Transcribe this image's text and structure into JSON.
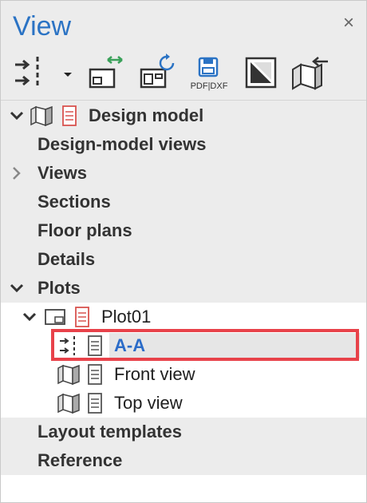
{
  "panel": {
    "title": "View",
    "close_symbol": "×"
  },
  "toolbar": {
    "buttons": [
      {
        "name": "section-cut-icon"
      },
      {
        "name": "dropdown-arrow-icon"
      },
      {
        "name": "layout-swap-icon"
      },
      {
        "name": "layout-refresh-icon"
      },
      {
        "name": "export-pdf-dxf-icon",
        "label": "PDF|DXF"
      },
      {
        "name": "render-toggle-icon"
      },
      {
        "name": "model-import-icon"
      }
    ]
  },
  "tree": {
    "design_model": "Design model",
    "design_model_views": "Design-model views",
    "views": "Views",
    "sections": "Sections",
    "floor_plans": "Floor plans",
    "details": "Details",
    "plots": "Plots",
    "plot01": "Plot01",
    "aa": "A-A",
    "front_view": "Front view",
    "top_view": "Top view",
    "layout_templates": "Layout templates",
    "reference": "Reference"
  },
  "colors": {
    "title_blue": "#2b73c4",
    "selection_text": "#2b6cc8",
    "highlight_red": "#e8424a",
    "panel_gray": "#ececec"
  }
}
